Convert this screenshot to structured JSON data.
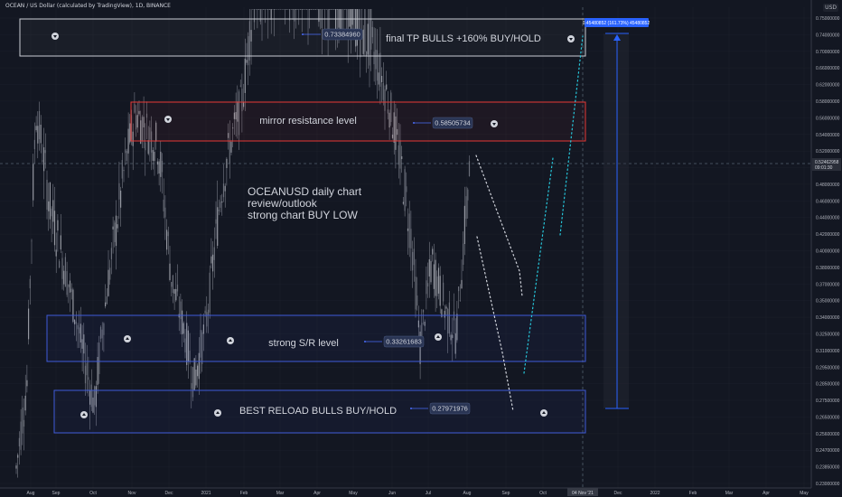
{
  "header": {
    "symbol_line": "OCEAN / US Dollar (calculated by TradingView), 1D, BINANCE",
    "currency": "USD"
  },
  "colors": {
    "bg": "#131722",
    "grid": "#2a2e39",
    "box_white": "#d1d4dc",
    "box_red": "#e53935",
    "box_blue": "#3f5bd9",
    "dot_white": "#d1d4dc",
    "dot_cyan": "#26c6da",
    "arrow_blue": "#2962ff",
    "label": "#2a3554",
    "label_text": "#d1d4dc",
    "price_axis_text": "#b2b5be"
  },
  "chart_data": {
    "type": "candlestick-annotated",
    "y_axis_ticks": [
      "0.75000000",
      "0.74000000",
      "0.70000000",
      "0.66000000",
      "0.62000000",
      "0.58000000",
      "0.56000000",
      "0.54000000",
      "0.52000000",
      "0.50000000",
      "0.48000000",
      "0.46000000",
      "0.44000000",
      "0.42000000",
      "0.40000000",
      "0.38000000",
      "0.37000000",
      "0.35000000",
      "0.34000000",
      "0.32500000",
      "0.31000000",
      "0.29500000",
      "0.28500000",
      "0.27500000",
      "0.26500000",
      "0.25600000",
      "0.24700000",
      "0.23850000",
      "0.23000000"
    ],
    "x_axis_ticks": [
      "Aug",
      "Sep",
      "Oct",
      "Nov",
      "Dec",
      "2021",
      "Feb",
      "Mar",
      "Apr",
      "May",
      "Jun",
      "Jul",
      "Aug",
      "Sep",
      "Oct",
      "04 Nov '21",
      "Dec",
      "2022",
      "Feb",
      "Mar",
      "Apr",
      "May"
    ],
    "current_price_label": "0.52462958",
    "current_time_label": "09:01:30",
    "target_label": "0.45480852 (161.73%) 45480852",
    "levels": [
      {
        "name": "final-tp",
        "price": 0.7338496,
        "label": "0.73384960",
        "note": "final TP BULLS +160% BUY/HOLD",
        "style": "white"
      },
      {
        "name": "mirror-resistance",
        "price": 0.58505734,
        "label": "0.58505734",
        "note": "mirror resistance level",
        "style": "red"
      },
      {
        "name": "strong-sr",
        "price": 0.33261683,
        "label": "0.33261683",
        "note": "strong S/R level",
        "style": "blue"
      },
      {
        "name": "best-reload",
        "price": 0.27971976,
        "label": "0.27971976",
        "note": "BEST RELOAD BULLS BUY/HOLD",
        "style": "blue"
      }
    ],
    "annotation": [
      "OCEANUSD daily chart",
      "review/outlook",
      "strong chart BUY LOW"
    ]
  }
}
